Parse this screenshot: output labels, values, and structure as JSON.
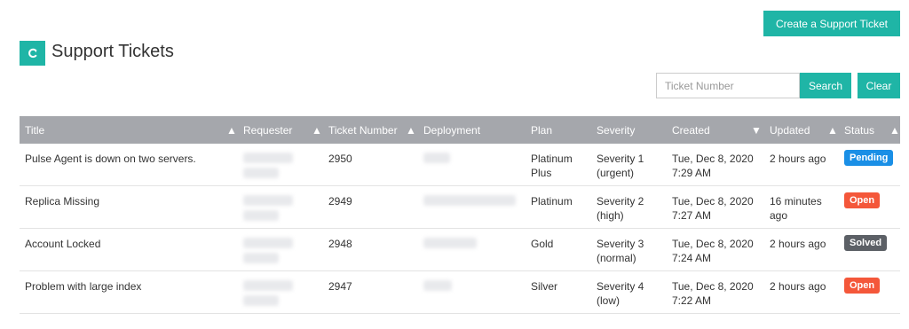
{
  "header": {
    "create_button": "Create a Support Ticket",
    "title": "Support Tickets"
  },
  "search": {
    "placeholder": "Ticket Number",
    "search_button": "Search",
    "clear_button": "Clear"
  },
  "colors": {
    "accent": "#1fb5a6",
    "header_bg": "#a5a7ac",
    "pending": "#1a8fe6",
    "open": "#f4573a",
    "solved": "#5c6066"
  },
  "table": {
    "columns": [
      "Title",
      "Requester",
      "Ticket Number",
      "Deployment",
      "Plan",
      "Severity",
      "Created",
      "Updated",
      "Status"
    ],
    "rows": [
      {
        "title": "Pulse Agent is down on two servers.",
        "ticket_number": "2950",
        "plan_line1": "Platinum",
        "plan_line2": "Plus",
        "severity_line1": "Severity 1",
        "severity_line2": "(urgent)",
        "created_line1": "Tue, Dec 8, 2020",
        "created_line2": "7:29 AM",
        "updated_line1": "2 hours ago",
        "updated_line2": "",
        "status": "Pending",
        "status_color": "#1a8fe6"
      },
      {
        "title": "Replica Missing",
        "ticket_number": "2949",
        "plan_line1": "Platinum",
        "plan_line2": "",
        "severity_line1": "Severity 2",
        "severity_line2": "(high)",
        "created_line1": "Tue, Dec 8, 2020",
        "created_line2": "7:27 AM",
        "updated_line1": "16 minutes",
        "updated_line2": "ago",
        "status": "Open",
        "status_color": "#f4573a"
      },
      {
        "title": "Account Locked",
        "ticket_number": "2948",
        "plan_line1": "Gold",
        "plan_line2": "",
        "severity_line1": "Severity 3",
        "severity_line2": "(normal)",
        "created_line1": "Tue, Dec 8, 2020",
        "created_line2": "7:24 AM",
        "updated_line1": "2 hours ago",
        "updated_line2": "",
        "status": "Solved",
        "status_color": "#5c6066"
      },
      {
        "title": "Problem with large index",
        "ticket_number": "2947",
        "plan_line1": "Silver",
        "plan_line2": "",
        "severity_line1": "Severity 4",
        "severity_line2": "(low)",
        "created_line1": "Tue, Dec 8, 2020",
        "created_line2": "7:22 AM",
        "updated_line1": "2 hours ago",
        "updated_line2": "",
        "status": "Open",
        "status_color": "#f4573a"
      }
    ]
  }
}
